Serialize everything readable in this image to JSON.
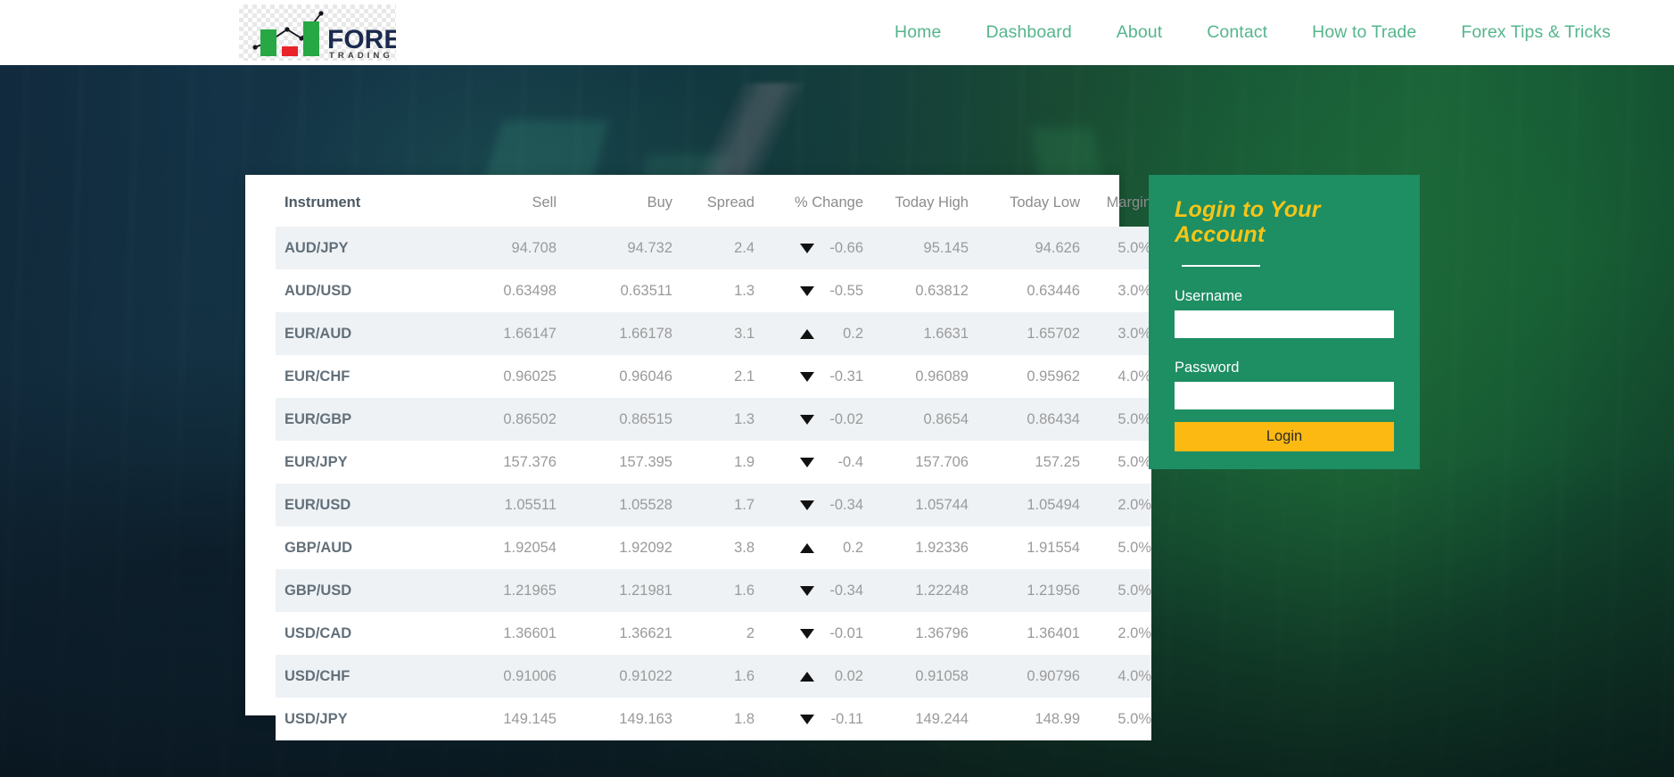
{
  "nav": {
    "logo": {
      "name": "forex-trading-logo",
      "primary_text": "FOREX",
      "secondary_text": "TRADING"
    },
    "links": [
      {
        "label": "Home"
      },
      {
        "label": "Dashboard"
      },
      {
        "label": "About"
      },
      {
        "label": "Contact"
      },
      {
        "label": "How to Trade"
      },
      {
        "label": "Forex Tips & Tricks"
      }
    ]
  },
  "quotes_table": {
    "headers": [
      "Instrument",
      "Sell",
      "Buy",
      "Spread",
      "% Change",
      "Today High",
      "Today Low",
      "Margin"
    ],
    "rows": [
      {
        "instrument": "AUD/JPY",
        "sell": "94.708",
        "buy": "94.732",
        "spread": "2.4",
        "dir": "down",
        "change": "-0.66",
        "high": "95.145",
        "low": "94.626",
        "margin": "5.0%"
      },
      {
        "instrument": "AUD/USD",
        "sell": "0.63498",
        "buy": "0.63511",
        "spread": "1.3",
        "dir": "down",
        "change": "-0.55",
        "high": "0.63812",
        "low": "0.63446",
        "margin": "3.0%"
      },
      {
        "instrument": "EUR/AUD",
        "sell": "1.66147",
        "buy": "1.66178",
        "spread": "3.1",
        "dir": "up",
        "change": "0.2",
        "high": "1.6631",
        "low": "1.65702",
        "margin": "3.0%"
      },
      {
        "instrument": "EUR/CHF",
        "sell": "0.96025",
        "buy": "0.96046",
        "spread": "2.1",
        "dir": "down",
        "change": "-0.31",
        "high": "0.96089",
        "low": "0.95962",
        "margin": "4.0%"
      },
      {
        "instrument": "EUR/GBP",
        "sell": "0.86502",
        "buy": "0.86515",
        "spread": "1.3",
        "dir": "down",
        "change": "-0.02",
        "high": "0.8654",
        "low": "0.86434",
        "margin": "5.0%"
      },
      {
        "instrument": "EUR/JPY",
        "sell": "157.376",
        "buy": "157.395",
        "spread": "1.9",
        "dir": "down",
        "change": "-0.4",
        "high": "157.706",
        "low": "157.25",
        "margin": "5.0%"
      },
      {
        "instrument": "EUR/USD",
        "sell": "1.05511",
        "buy": "1.05528",
        "spread": "1.7",
        "dir": "down",
        "change": "-0.34",
        "high": "1.05744",
        "low": "1.05494",
        "margin": "2.0%"
      },
      {
        "instrument": "GBP/AUD",
        "sell": "1.92054",
        "buy": "1.92092",
        "spread": "3.8",
        "dir": "up",
        "change": "0.2",
        "high": "1.92336",
        "low": "1.91554",
        "margin": "5.0%"
      },
      {
        "instrument": "GBP/USD",
        "sell": "1.21965",
        "buy": "1.21981",
        "spread": "1.6",
        "dir": "down",
        "change": "-0.34",
        "high": "1.22248",
        "low": "1.21956",
        "margin": "5.0%"
      },
      {
        "instrument": "USD/CAD",
        "sell": "1.36601",
        "buy": "1.36621",
        "spread": "2",
        "dir": "down",
        "change": "-0.01",
        "high": "1.36796",
        "low": "1.36401",
        "margin": "2.0%"
      },
      {
        "instrument": "USD/CHF",
        "sell": "0.91006",
        "buy": "0.91022",
        "spread": "1.6",
        "dir": "up",
        "change": "0.02",
        "high": "0.91058",
        "low": "0.90796",
        "margin": "4.0%"
      },
      {
        "instrument": "USD/JPY",
        "sell": "149.145",
        "buy": "149.163",
        "spread": "1.8",
        "dir": "down",
        "change": "-0.11",
        "high": "149.244",
        "low": "148.99",
        "margin": "5.0%"
      }
    ]
  },
  "login": {
    "title": "Login to Your Account",
    "username_label": "Username",
    "username_value": "",
    "username_placeholder": "",
    "password_label": "Password",
    "password_value": "",
    "password_placeholder": "",
    "submit_label": "Login"
  },
  "colors": {
    "nav_link": "#55b58c",
    "login_panel": "#1e8e63",
    "login_title": "#f5c518",
    "login_button": "#fcb912",
    "row_stripe": "#eef2f5",
    "logo_green": "#28a745",
    "logo_red": "#e8242a",
    "logo_navy": "#1b2a4e"
  }
}
